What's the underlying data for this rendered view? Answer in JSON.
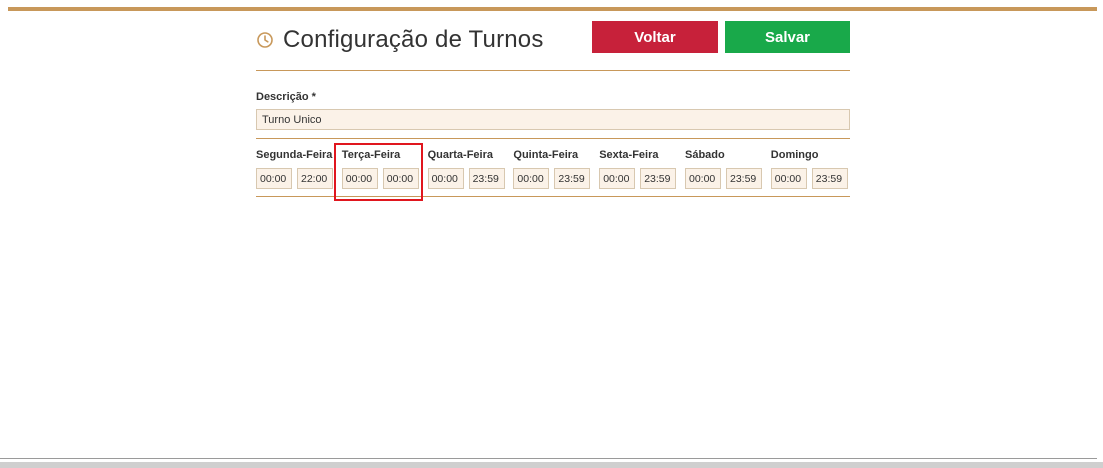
{
  "header": {
    "title": "Configuração de Turnos",
    "icon": "clock-icon",
    "back_label": "Voltar",
    "save_label": "Salvar"
  },
  "description": {
    "label": "Descrição *",
    "value": "Turno Unico"
  },
  "days": [
    {
      "label": "Segunda-Feira",
      "start": "00:00",
      "end": "22:00"
    },
    {
      "label": "Terça-Feira",
      "start": "00:00",
      "end": "00:00"
    },
    {
      "label": "Quarta-Feira",
      "start": "00:00",
      "end": "23:59"
    },
    {
      "label": "Quinta-Feira",
      "start": "00:00",
      "end": "23:59"
    },
    {
      "label": "Sexta-Feira",
      "start": "00:00",
      "end": "23:59"
    },
    {
      "label": "Sábado",
      "start": "00:00",
      "end": "23:59"
    },
    {
      "label": "Domingo",
      "start": "00:00",
      "end": "23:59"
    }
  ],
  "colors": {
    "accent": "#c8985a",
    "back_button": "#c7213a",
    "save_button": "#19a94a",
    "input_background": "#fbf2e8",
    "highlight": "#e0161e"
  }
}
